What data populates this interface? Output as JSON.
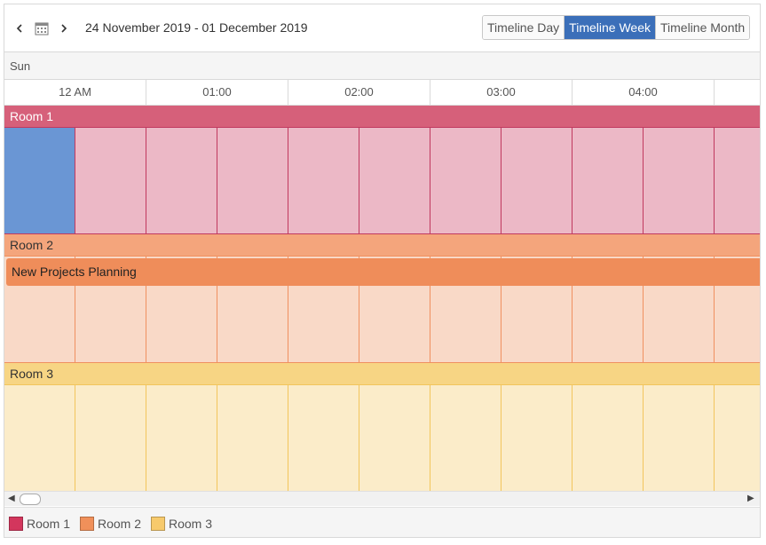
{
  "toolbar": {
    "date_range": "24 November 2019 - 01 December 2019",
    "prev_icon": "chevron-left-icon",
    "calendar_icon": "calendar-icon",
    "next_icon": "chevron-right-icon",
    "views": [
      {
        "label": "Timeline Day",
        "active": false
      },
      {
        "label": "Timeline Week",
        "active": true
      },
      {
        "label": "Timeline Month",
        "active": false
      }
    ]
  },
  "timeline": {
    "day_label": "Sun",
    "hours": [
      "12 AM",
      "01:00",
      "02:00",
      "03:00",
      "04:00",
      ""
    ]
  },
  "groups": [
    {
      "name": "Room 1",
      "header_color": "#d6607a",
      "cell_color": "#ecb8c6",
      "border_color": "#c0395f",
      "text_color": "#ffffff"
    },
    {
      "name": "Room 2",
      "header_color": "#f4a57c",
      "cell_color": "#f9d9c7",
      "border_color": "#f09060",
      "text_color": "#333333"
    },
    {
      "name": "Room 3",
      "header_color": "#f7d584",
      "cell_color": "#fbecc9",
      "border_color": "#f2c55c",
      "text_color": "#333333"
    }
  ],
  "selection": {
    "color": "#6a96d4"
  },
  "appointments": [
    {
      "title": "New Projects Planning",
      "group": "Room 2",
      "color": "#ef8d5a"
    }
  ],
  "legend": [
    {
      "label": "Room 1",
      "color": "#d3365d"
    },
    {
      "label": "Room 2",
      "color": "#f0905a"
    },
    {
      "label": "Room 3",
      "color": "#f7ca6c"
    }
  ]
}
